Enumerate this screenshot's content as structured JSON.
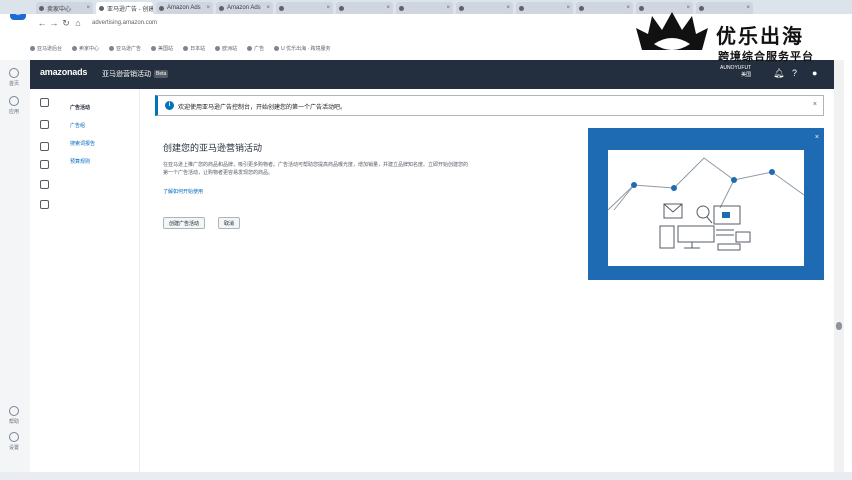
{
  "browser": {
    "tabs": [
      {
        "label": "卖家中心"
      },
      {
        "label": "亚马逊广告 - 创建"
      },
      {
        "label": "Amazon Ads"
      },
      {
        "label": "Amazon Ads"
      },
      {
        "label": ""
      },
      {
        "label": ""
      },
      {
        "label": ""
      },
      {
        "label": ""
      },
      {
        "label": ""
      },
      {
        "label": ""
      },
      {
        "label": ""
      },
      {
        "label": ""
      }
    ],
    "url": "advertising.amazon.com"
  },
  "bookmarks": [
    "亚马逊后台",
    "卖家中心",
    "亚马逊广告",
    "美国站",
    "日本站",
    "欧洲站",
    "广告",
    "U 优乐出海 · 跨境服务"
  ],
  "rail": [
    {
      "label": "首页"
    },
    {
      "label": "应用"
    },
    {
      "label": "帮助"
    },
    {
      "label": "设置"
    }
  ],
  "ads_header": {
    "logo": "amazonads",
    "title": "亚马逊营销活动",
    "badge": "Beta",
    "account_line1": "AUNOYUFUT",
    "account_line2": "美国",
    "bell_icon": "bell-icon",
    "help_icon": "help-icon",
    "user_icon": "user-icon"
  },
  "subnav": {
    "links": [
      {
        "label": "广告活动"
      },
      {
        "label": "广告组"
      },
      {
        "label": "搜索词报告"
      },
      {
        "label": "预算规则"
      }
    ]
  },
  "alert": {
    "message": "欢迎使用亚马逊广告控制台，开始创建您的第一个广告活动吧。"
  },
  "main": {
    "heading": "创建您的亚马逊营销活动",
    "description": "在亚马逊上推广您的商品和品牌，吸引更多购物者。广告活动可帮助您提高商品曝光度，增加销量，并建立品牌知名度。立即开始创建您的第一个广告活动，让购物者更容易发现您的商品。",
    "learn_more": "了解如何开始使用",
    "primary_button": "创建广告活动",
    "secondary_button": "取消"
  },
  "watermark": {
    "line1": "优乐出海",
    "line2": "跨境综合服务平台"
  },
  "colors": {
    "ads_header_bg": "#232f3e",
    "illustration_blue": "#1e6bb3",
    "link_blue": "#0066c0"
  }
}
